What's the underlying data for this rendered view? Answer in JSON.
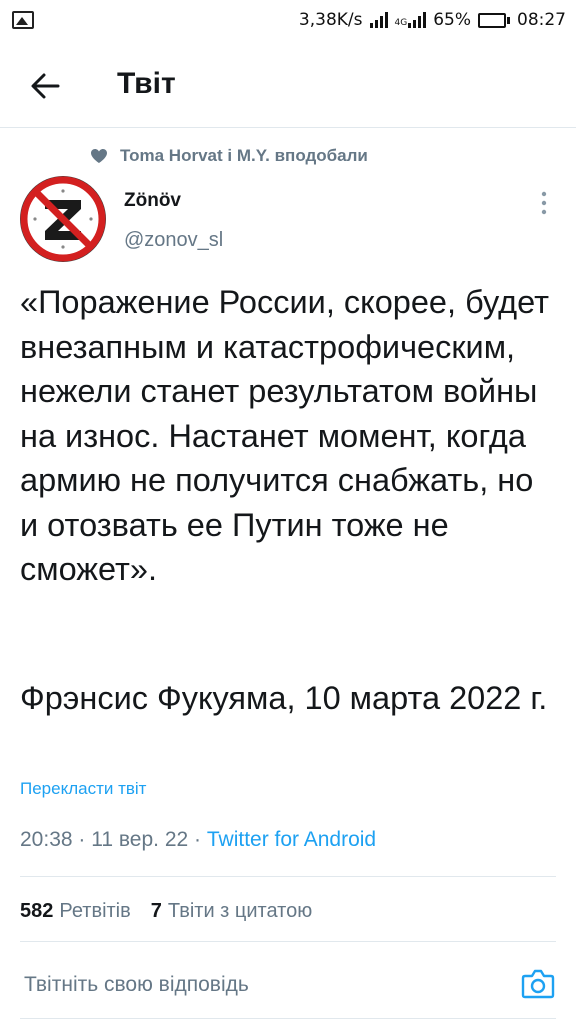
{
  "status_bar": {
    "network_speed": "3,38K/s",
    "network_type": "4G",
    "battery_percent": "65%",
    "battery_level": 0.65,
    "time": "08:27"
  },
  "header": {
    "back_icon": "arrow-left-icon",
    "title": "Твіт"
  },
  "social_context": {
    "icon": "heart-icon",
    "text": "Toma Horvat і M.Y. вподобали"
  },
  "tweet": {
    "author": {
      "name": "Zönöv",
      "handle": "@zonov_sl",
      "avatar": "z-prohibited-sign-avatar"
    },
    "text": "«Поражение России, скорее, будет внезапным и катастрофическим, нежели станет результатом войны на износ. Настанет момент, когда армию не получится снабжать, но и отозвать ее Путин тоже не сможет».",
    "attribution": "Фрэнсис Фукуяма,  10 марта 2022 г.",
    "translate_label": "Перекласти твіт",
    "time": "20:38",
    "date": "11 вер. 22",
    "separator": " · ",
    "source": "Twitter for Android",
    "retweets_count": "582",
    "retweets_label": "Ретвітів",
    "quotes_count": "7",
    "quotes_label": "Твіти з цитатою"
  },
  "reply": {
    "placeholder": "Твітніть свою відповідь",
    "camera_icon": "camera-icon"
  },
  "colors": {
    "accent": "#1da1f2",
    "secondary_text": "#657786",
    "divider": "#e1e8ed"
  }
}
